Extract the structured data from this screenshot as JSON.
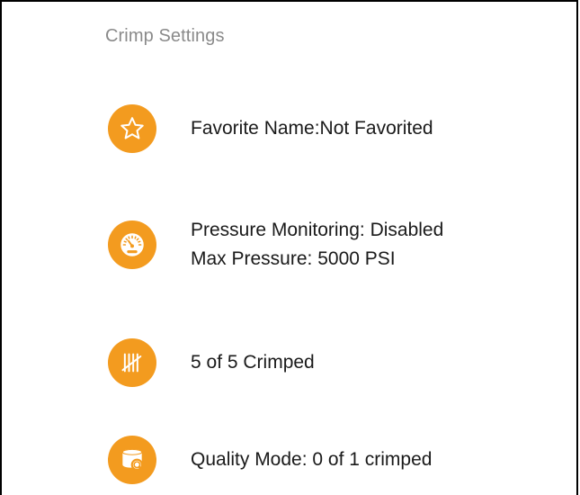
{
  "section_title": "Crimp Settings",
  "colors": {
    "accent": "#f39b1f",
    "title": "#8a8a8a",
    "text": "#1a1a1a"
  },
  "items": [
    {
      "icon": "star-icon",
      "lines": [
        "Favorite Name:Not Favorited"
      ]
    },
    {
      "icon": "pressure-gauge-icon",
      "lines": [
        "Pressure Monitoring: Disabled",
        "Max Pressure: 5000 PSI"
      ]
    },
    {
      "icon": "tally-count-icon",
      "lines": [
        "5 of 5 Crimped"
      ]
    },
    {
      "icon": "quality-inspect-icon",
      "lines": [
        "Quality Mode: 0 of 1 crimped"
      ]
    }
  ]
}
